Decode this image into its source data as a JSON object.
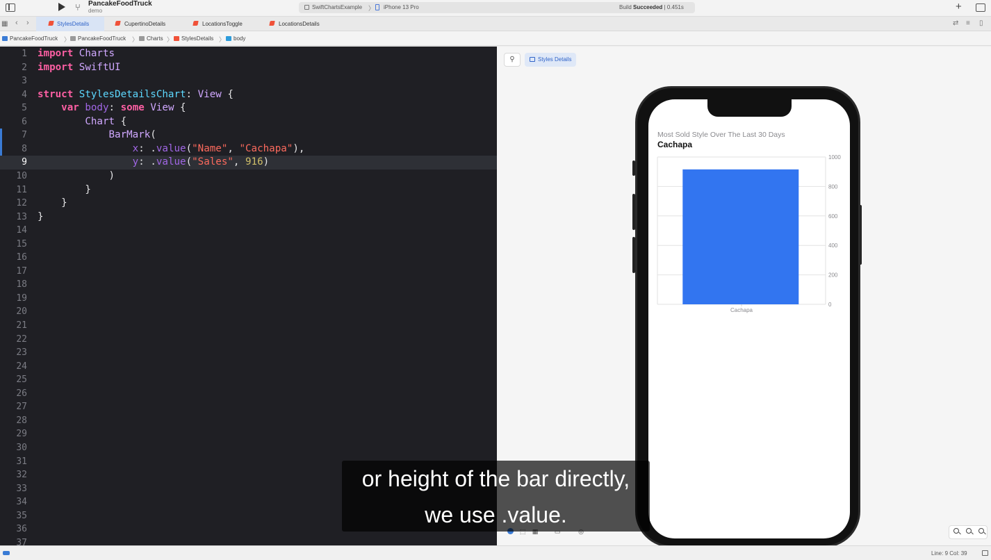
{
  "window": {
    "project": "PancakeFoodTruck",
    "subtitle": "demo",
    "scheme": "SwiftChartsExample",
    "device": "iPhone 13 Pro",
    "build_status_prefix": "Build",
    "build_status_bold": "Succeeded",
    "build_time": "| 0.451s"
  },
  "tabs": [
    {
      "label": "StylesDetails",
      "active": true
    },
    {
      "label": "CupertinoDetails",
      "active": false
    },
    {
      "label": "LocationsToggle",
      "active": false
    },
    {
      "label": "LocationsDetails",
      "active": false
    }
  ],
  "breadcrumb": [
    "PancakeFoodTruck",
    "PancakeFoodTruck",
    "Charts",
    "StylesDetails",
    "body"
  ],
  "editor": {
    "current_line": 9,
    "total_lines": 37,
    "code_lines": [
      "import Charts",
      "import SwiftUI",
      "",
      "struct StylesDetailsChart: View {",
      "    var body: some View {",
      "        Chart {",
      "            BarMark(",
      "                x: .value(\"Name\", \"Cachapa\"),",
      "                y: .value(\"Sales\", 916)",
      "            )",
      "        }",
      "    }",
      "}"
    ]
  },
  "canvas": {
    "preview_label": "Styles Details"
  },
  "preview": {
    "subtitle": "Most Sold Style Over The Last 30 Days",
    "title": "Cachapa"
  },
  "chart_data": {
    "type": "bar",
    "categories": [
      "Cachapa"
    ],
    "values": [
      916
    ],
    "ylim": [
      0,
      1000
    ],
    "yticks": [
      0,
      200,
      400,
      600,
      800,
      1000
    ],
    "grid": true,
    "bar_color": "#3275f0",
    "title": "Cachapa",
    "subtitle": "Most Sold Style Over The Last 30 Days"
  },
  "status": {
    "position": "Line: 9  Col: 39"
  },
  "caption": {
    "line1": "or height of the bar directly,",
    "line2": "we use .value."
  }
}
